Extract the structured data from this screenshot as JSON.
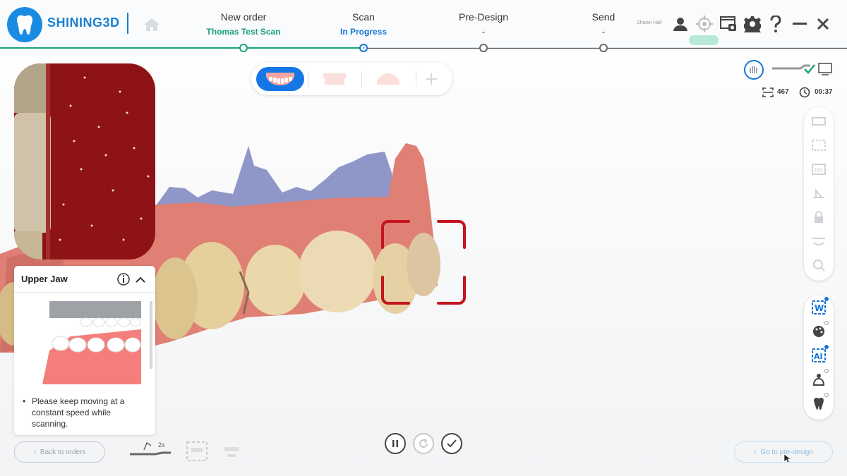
{
  "app": {
    "brand": "SHINING3D",
    "user_name": "Shawn Hall"
  },
  "steps": [
    {
      "title": "New order",
      "sub": "Thomas Test Scan"
    },
    {
      "title": "Scan",
      "sub": "In Progress"
    },
    {
      "title": "Pre-Design",
      "sub": "-"
    },
    {
      "title": "Send",
      "sub": "-"
    }
  ],
  "stats": {
    "frames": "467",
    "time": "00:37"
  },
  "jaw_panel": {
    "title": "Upper Jaw",
    "tip": "Please keep moving at a constant speed while scanning."
  },
  "scan_speed": "2x",
  "buttons": {
    "back": "Back to orders",
    "go": "Go to pre-design"
  },
  "colors": {
    "accent": "#1576d6",
    "done": "#1aa27a",
    "focus_box": "#c4141f",
    "gum": "#e07f74",
    "tooth": "#e9d3a6"
  }
}
